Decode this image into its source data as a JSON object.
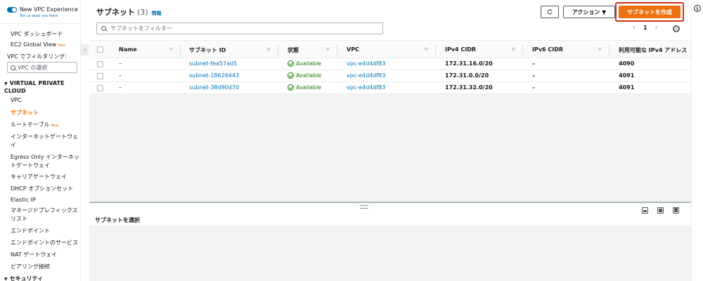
{
  "sidebar": {
    "toggle_title": "New VPC Experience",
    "toggle_sub": "Tell us what you think",
    "dashboard": "VPC ダッシュボード",
    "ec2_global": "EC2 Global View",
    "new_badge": "New",
    "filter_label": "VPC でフィルタリング:",
    "vpc_select_placeholder": "VPC の選択",
    "section_vpc": "VIRTUAL PRIVATE CLOUD",
    "items": [
      "VPC",
      "サブネット",
      "ルートテーブル",
      "インターネットゲートウェイ",
      "Egress Only インターネットゲートウェイ",
      "キャリアゲートウェイ",
      "DHCP オプションセット",
      "Elastic IP",
      "マネージドプレフィックスリスト",
      "エンドポイント",
      "エンドポイントのサービス",
      "NAT ゲートウェイ",
      "ピアリング接続"
    ],
    "section_security": "セキュリティ"
  },
  "header": {
    "title": "サブネット",
    "count": "(3)",
    "info": "情報",
    "actions_label": "アクション ▼",
    "create_label": "サブネットを作成"
  },
  "filter": {
    "placeholder": "サブネットをフィルター"
  },
  "pager": {
    "prev": "‹",
    "page": "1",
    "next": "›"
  },
  "table": {
    "columns": [
      "Name",
      "サブネット ID",
      "状態",
      "VPC",
      "IPv4 CIDR",
      "IPv6 CIDR",
      "利用可能な IPv4 アドレス"
    ],
    "rows": [
      {
        "name": "–",
        "subnet_id": "subnet-fea57ad5",
        "state": "Available",
        "vpc": "vpc-e4d4df83",
        "ipv4": "172.31.16.0/20",
        "ipv6": "–",
        "available": "4090"
      },
      {
        "name": "–",
        "subnet_id": "subnet-18626443",
        "state": "Available",
        "vpc": "vpc-e4d4df83",
        "ipv4": "172.31.0.0/20",
        "ipv6": "–",
        "available": "4091"
      },
      {
        "name": "–",
        "subnet_id": "subnet-38d90d70",
        "state": "Available",
        "vpc": "vpc-e4d4df83",
        "ipv4": "172.31.32.0/20",
        "ipv6": "–",
        "available": "4091"
      }
    ]
  },
  "detail": {
    "title": "サブネットを選択"
  },
  "colors": {
    "accent": "#ec7211",
    "link": "#0073bb",
    "success": "#1d8102",
    "highlight": "#d13212"
  }
}
